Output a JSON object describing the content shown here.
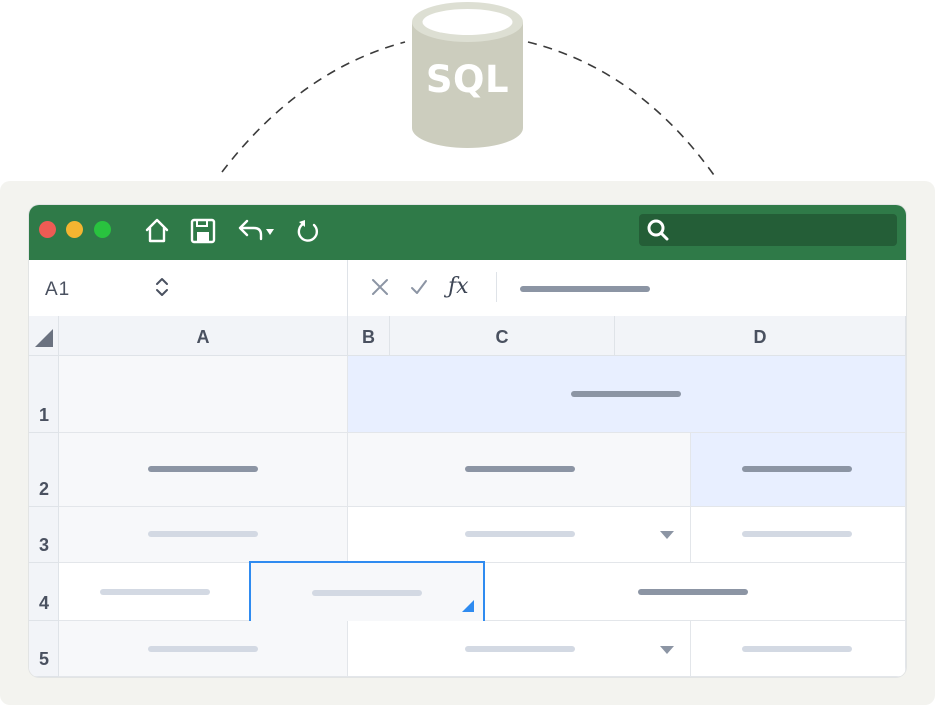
{
  "database": {
    "label": "SQL",
    "body_color": "#cccdbe"
  },
  "toolbar": {
    "colors": {
      "background": "#2f7a48",
      "search_bg": "#245e37"
    },
    "window_controls": [
      "close",
      "minimize",
      "maximize"
    ],
    "icons": [
      "home-icon",
      "save-icon",
      "undo-icon",
      "redo-icon",
      "search-icon"
    ]
  },
  "formula_bar": {
    "cell_ref": "A1",
    "fx_label": "ƒx"
  },
  "grid": {
    "columns": [
      "A",
      "B",
      "C",
      "D"
    ],
    "rows": [
      "1",
      "2",
      "3",
      "4",
      "5"
    ],
    "accent": "#2f8bf0"
  }
}
